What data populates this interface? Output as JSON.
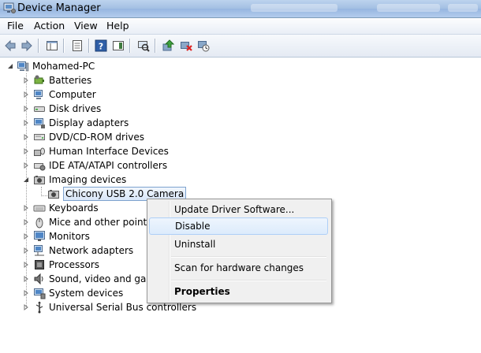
{
  "window": {
    "title": "Device Manager"
  },
  "menu": [
    "File",
    "Action",
    "View",
    "Help"
  ],
  "toolbar": [
    "back-arrow-icon",
    "forward-arrow-icon",
    "show-hide-console-tree-icon",
    "properties-icon",
    "help-icon",
    "action-pane-icon",
    "scan-hardware-icon",
    "update-driver-icon",
    "disable-device-icon",
    "uninstall-device-icon"
  ],
  "tree": {
    "root": "Mohamed-PC",
    "categories": [
      "Batteries",
      "Computer",
      "Disk drives",
      "Display adapters",
      "DVD/CD-ROM drives",
      "Human Interface Devices",
      "IDE ATA/ATAPI controllers",
      "Imaging devices",
      "Keyboards",
      "Mice and other pointing",
      "Monitors",
      "Network adapters",
      "Processors",
      "Sound, video and game",
      "System devices",
      "Universal Serial Bus controllers"
    ],
    "selected_device": "Chicony USB 2.0 Camera"
  },
  "context_menu": {
    "update_driver": "Update Driver Software...",
    "disable": "Disable",
    "uninstall": "Uninstall",
    "scan": "Scan for hardware changes",
    "properties": "Properties"
  }
}
